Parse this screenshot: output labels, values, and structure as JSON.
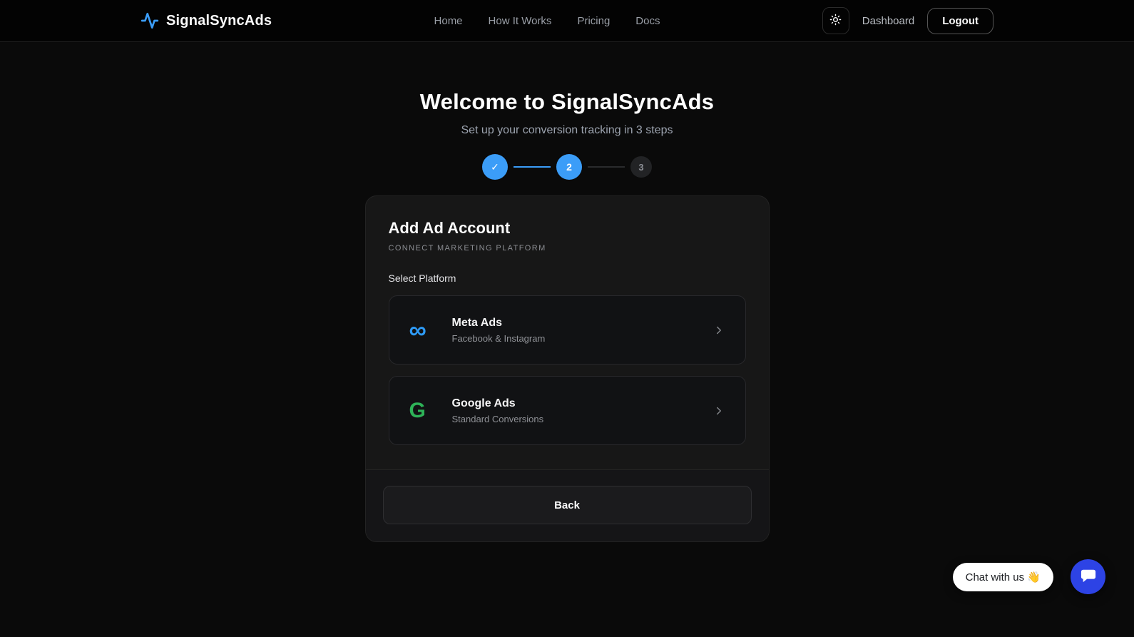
{
  "navbar": {
    "brand": "SignalSyncAds",
    "links": [
      {
        "label": "Home"
      },
      {
        "label": "How It Works"
      },
      {
        "label": "Pricing"
      },
      {
        "label": "Docs"
      }
    ],
    "dashboard_label": "Dashboard",
    "logout_label": "Logout"
  },
  "hero": {
    "title": "Welcome to SignalSyncAds",
    "subtitle": "Set up your conversion tracking in 3 steps"
  },
  "stepper": {
    "steps": [
      {
        "id": 1,
        "state": "completed",
        "label": "✓"
      },
      {
        "id": 2,
        "state": "active",
        "label": "2"
      },
      {
        "id": 3,
        "state": "upcoming",
        "label": "3"
      }
    ]
  },
  "card": {
    "title": "Add Ad Account",
    "subtitle": "CONNECT MARKETING PLATFORM",
    "section_label": "Select Platform",
    "platforms": [
      {
        "name": "Meta Ads",
        "description": "Facebook & Instagram",
        "icon": "meta-infinity-icon",
        "icon_glyph": "∞",
        "icon_color": "#2e9bf7"
      },
      {
        "name": "Google Ads",
        "description": "Standard Conversions",
        "icon": "google-g-icon",
        "icon_glyph": "G",
        "icon_color": "#2eb358"
      }
    ],
    "back_label": "Back"
  },
  "chat": {
    "label": "Chat with us 👋"
  },
  "colors": {
    "accent_blue": "#3b9df8",
    "google_green": "#2eb358",
    "chat_blue": "#2d43e5",
    "page_background": "#0a0a0a",
    "card_background": "#171717"
  }
}
